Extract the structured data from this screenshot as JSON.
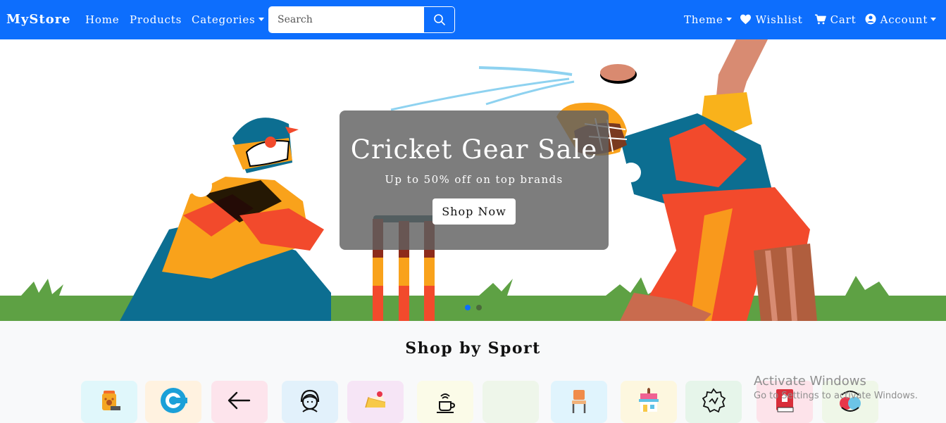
{
  "navbar": {
    "brand": "MyStore",
    "links": [
      "Home",
      "Products",
      "Categories"
    ],
    "search_placeholder": "Search",
    "right_links": [
      "Theme",
      "Wishlist",
      "Cart",
      "Account"
    ],
    "background": "#0d6efd"
  },
  "hero": {
    "title": "Cricket Gear Sale",
    "subtitle": "Up to 50% off on top brands",
    "button": "Shop Now",
    "slides": 2,
    "active_slide": 1
  },
  "sports": {
    "title": "Shop by Sport",
    "tiles": [
      {
        "icon": "pet-food-icon",
        "bg": "#e0f7fb"
      },
      {
        "icon": "c-letter-icon",
        "bg": "#fff2e0"
      },
      {
        "icon": "arrow-left-icon",
        "bg": "#fde4ec"
      },
      {
        "icon": "headset-agent-icon",
        "bg": "#e2f1fb"
      },
      {
        "icon": "cake-icon",
        "bg": "#f6e5f6"
      },
      {
        "icon": "coffee-cup-icon",
        "bg": "#fbfbe8"
      },
      {
        "icon": "blank-icon",
        "bg": "#eef6ea"
      },
      {
        "icon": "chair-icon",
        "bg": "#e0f4fd"
      },
      {
        "icon": "shop-icon",
        "bg": "#fdf7df"
      },
      {
        "icon": "badge-icon",
        "bg": "#e6f5ea"
      },
      {
        "icon": "book-icon",
        "bg": "#fde3ea"
      },
      {
        "icon": "translate-icon",
        "bg": "#eff7e8"
      }
    ]
  },
  "watermark": {
    "line1": "Activate Windows",
    "line2": "Go to Settings to activate Windows."
  }
}
